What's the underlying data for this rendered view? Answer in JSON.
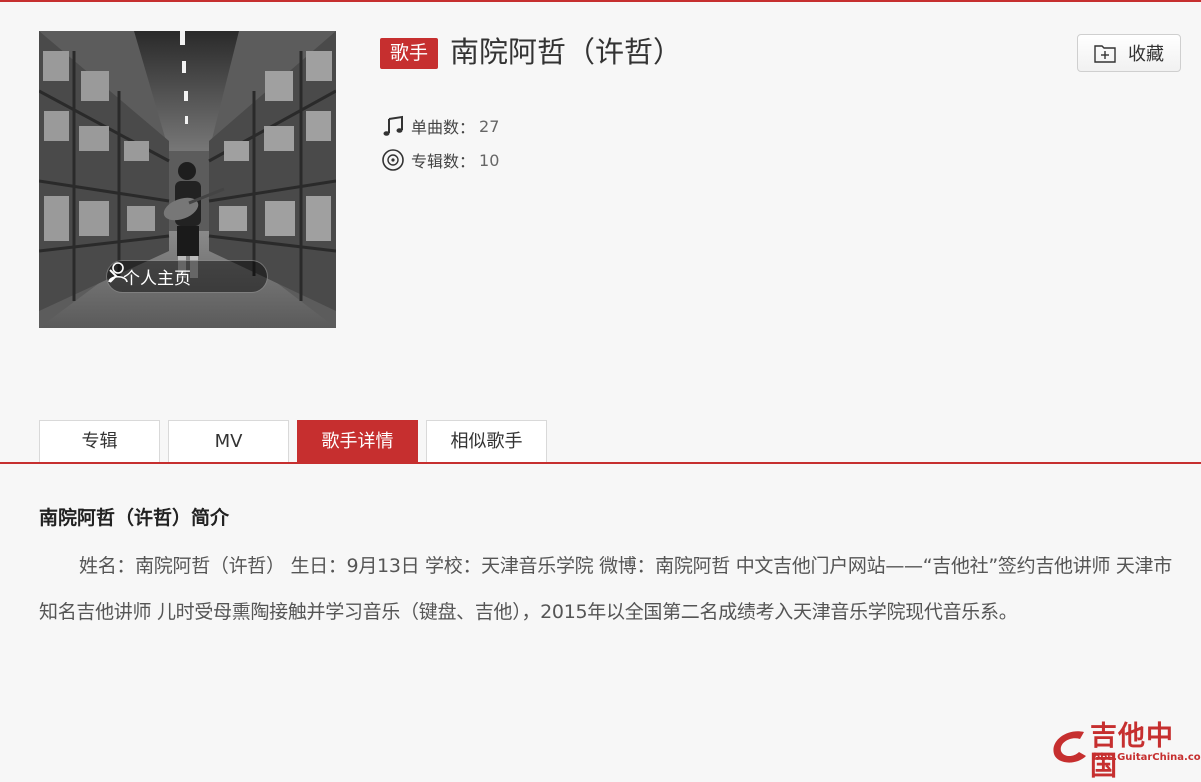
{
  "header": {
    "tag": "歌手",
    "artist_name": "南院阿哲（许哲）",
    "favorite_label": "收藏",
    "homepage_label": "个人主页",
    "stats": {
      "singles_label": "单曲数：",
      "singles_count": "27",
      "albums_label": "专辑数：",
      "albums_count": "10"
    }
  },
  "tabs": [
    {
      "label": "专辑",
      "active": false
    },
    {
      "label": "MV",
      "active": false
    },
    {
      "label": "歌手详情",
      "active": true
    },
    {
      "label": "相似歌手",
      "active": false
    }
  ],
  "intro": {
    "title": "南院阿哲（许哲）简介",
    "body": "姓名：南院阿哲（许哲） 生日：9月13日 学校：天津音乐学院 微博：南院阿哲 中文吉他门户网站——“吉他社”签约吉他讲师 天津市知名吉他讲师 儿时受母熏陶接触并学习音乐（键盘、吉他），2015年以全国第二名成绩考入天津音乐学院现代音乐系。"
  },
  "watermark": {
    "text": "吉他中国",
    "url": "bbs.GuitarChina.com"
  },
  "colors": {
    "accent": "#c62f2f",
    "background": "#f7f7f7"
  },
  "icons": {
    "singles": "music-note-icon",
    "albums": "disc-icon",
    "favorite": "folder-plus-icon",
    "homepage": "user-icon"
  }
}
